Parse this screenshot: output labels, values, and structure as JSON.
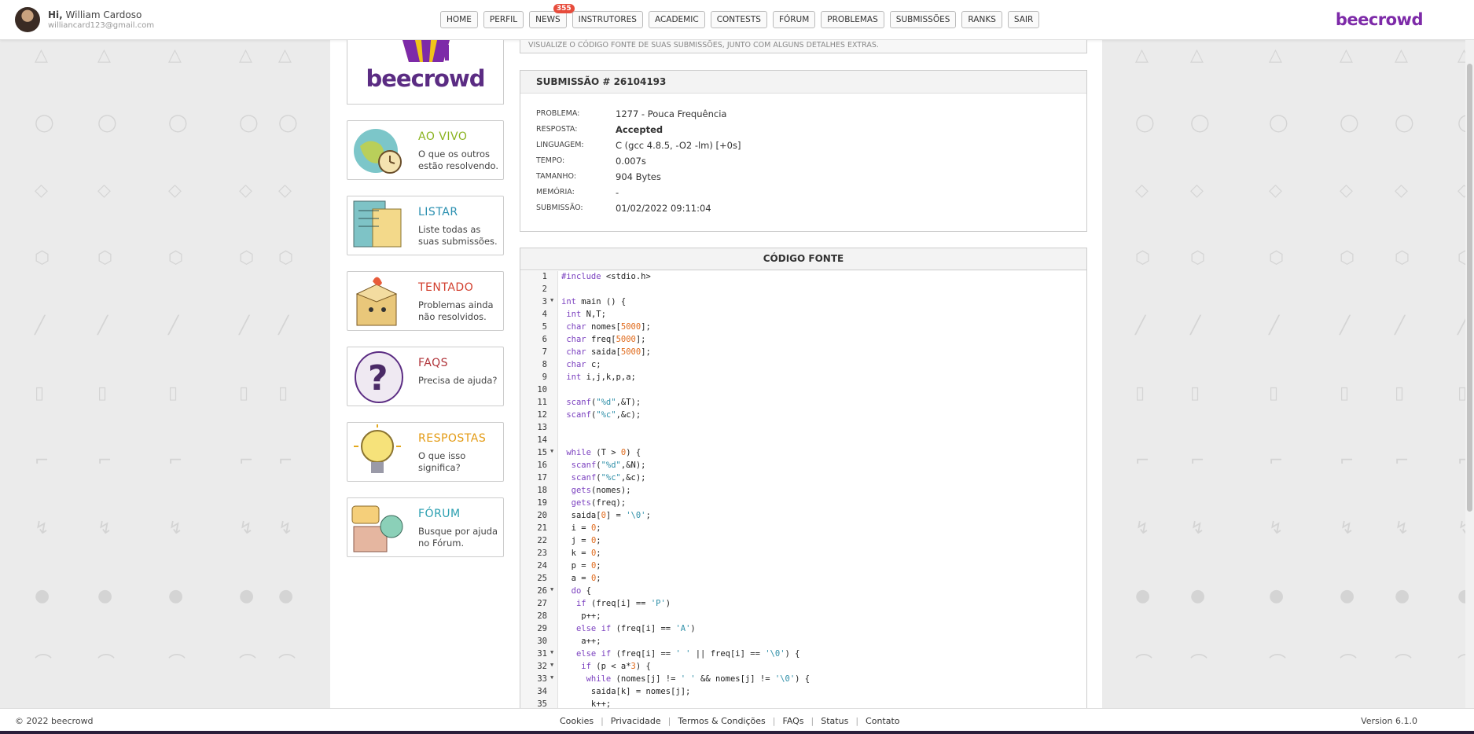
{
  "user": {
    "greeting": "Hi,",
    "name": "William Cardoso",
    "email": "williancard123@gmail.com"
  },
  "nav": {
    "items": [
      "HOME",
      "PERFIL",
      "NEWS",
      "INSTRUTORES",
      "ACADEMIC",
      "CONTESTS",
      "FÓRUM",
      "PROBLEMAS",
      "SUBMISSÕES",
      "RANKS",
      "SAIR"
    ],
    "news_badge": "355"
  },
  "brand": "beecrowd",
  "sidebar": {
    "logo_text": "beecrowd",
    "cards": [
      {
        "title": "AO VIVO",
        "desc": "O que os outros estão resolvendo.",
        "color": "#8ab31f"
      },
      {
        "title": "LISTAR",
        "desc": "Liste todas as suas submissões.",
        "color": "#2a8fb0"
      },
      {
        "title": "TENTADO",
        "desc": "Problemas ainda não resolvidos.",
        "color": "#d23f2e"
      },
      {
        "title": "FAQS",
        "desc": "Precisa de ajuda?",
        "color": "#b0343a"
      },
      {
        "title": "RESPOSTAS",
        "desc": "O que isso significa?",
        "color": "#e39a12"
      },
      {
        "title": "FÓRUM",
        "desc": "Busque por ajuda no Fórum.",
        "color": "#2a9fb0"
      }
    ]
  },
  "hint": "VISUALIZE O CÓDIGO FONTE DE SUAS SUBMISSÕES, JUNTO COM ALGUNS DETALHES EXTRAS.",
  "submission": {
    "header": "SUBMISSÃO # 26104193",
    "rows": [
      {
        "label": "PROBLEMA:",
        "value": "1277 - Pouca Frequência"
      },
      {
        "label": "RESPOSTA:",
        "value": "Accepted"
      },
      {
        "label": "LINGUAGEM:",
        "value": "C (gcc 4.8.5, -O2 -lm) [+0s]"
      },
      {
        "label": "TEMPO:",
        "value": "0.007s"
      },
      {
        "label": "TAMANHO:",
        "value": "904 Bytes"
      },
      {
        "label": "MEMÓRIA:",
        "value": "-"
      },
      {
        "label": "SUBMISSÃO:",
        "value": "01/02/2022 09:11:04"
      }
    ]
  },
  "code": {
    "header": "CÓDIGO FONTE",
    "fold_lines": [
      3,
      15,
      26,
      31,
      32,
      33
    ],
    "lines": [
      "#include <stdio.h>",
      "",
      "int main () {",
      " int N,T;",
      " char nomes[5000];",
      " char freq[5000];",
      " char saida[5000];",
      " char c;",
      " int i,j,k,p,a;",
      "",
      " scanf(\"%d\",&T);",
      " scanf(\"%c\",&c);",
      "",
      "",
      " while (T > 0) {",
      "  scanf(\"%d\",&N);",
      "  scanf(\"%c\",&c);",
      "  gets(nomes);",
      "  gets(freq);",
      "  saida[0] = '\\0';",
      "  i = 0;",
      "  j = 0;",
      "  k = 0;",
      "  p = 0;",
      "  a = 0;",
      "  do {",
      "   if (freq[i] == 'P')",
      "    p++;",
      "   else if (freq[i] == 'A')",
      "    a++;",
      "   else if (freq[i] == ' ' || freq[i] == '\\0') {",
      "    if (p < a*3) {",
      "     while (nomes[j] != ' ' && nomes[j] != '\\0') {",
      "      saida[k] = nomes[j];",
      "      k++;"
    ]
  },
  "footer": {
    "copyright": "© 2022 beecrowd",
    "links": [
      "Cookies",
      "Privacidade",
      "Termos & Condições",
      "FAQs",
      "Status",
      "Contato"
    ],
    "version": "Version 6.1.0"
  }
}
